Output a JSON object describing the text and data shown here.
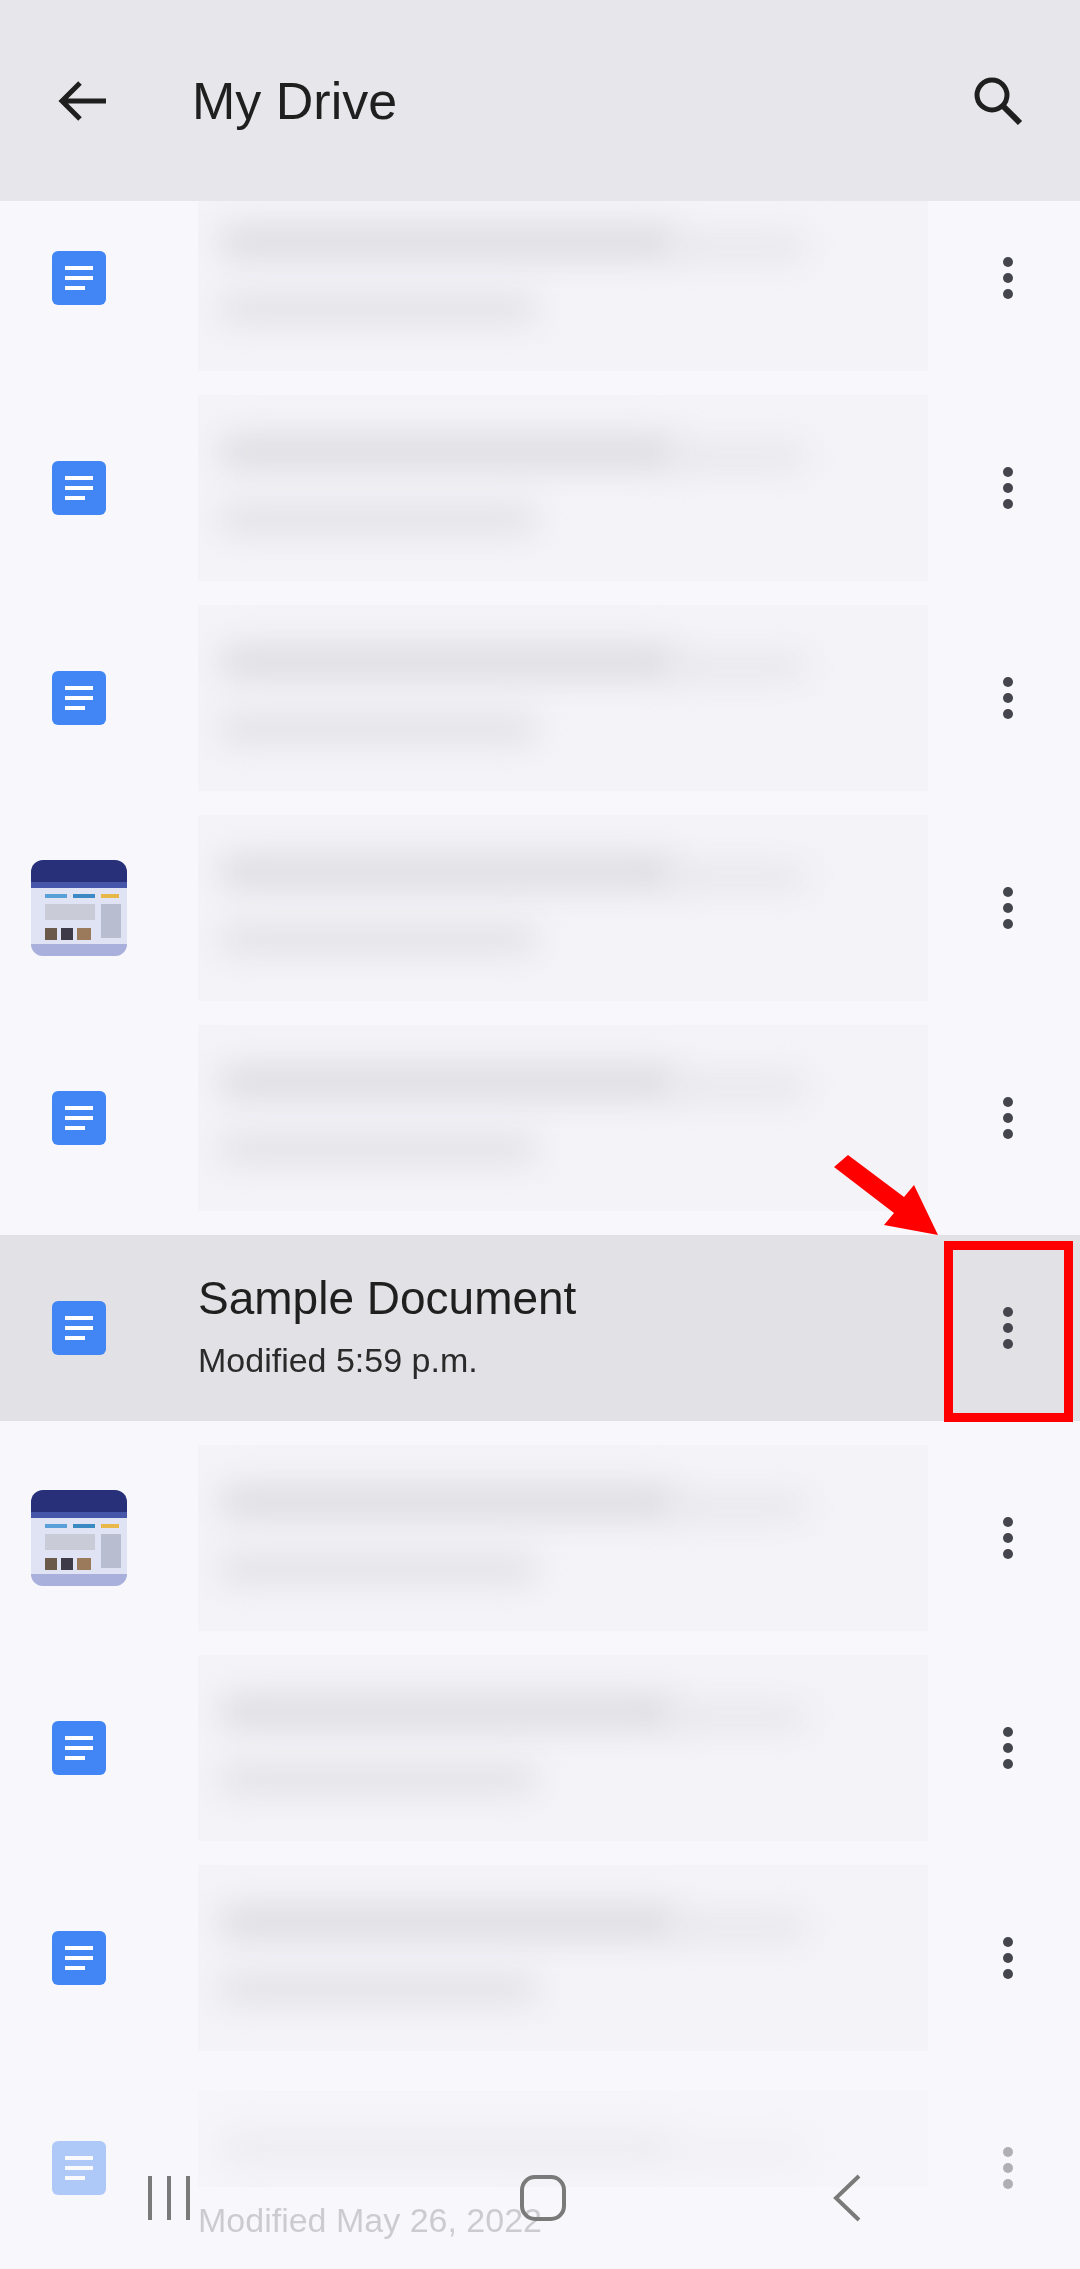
{
  "header": {
    "title": "My Drive"
  },
  "rows": [
    {
      "kind": "doc",
      "redacted": true,
      "selected": false,
      "annotated": false
    },
    {
      "kind": "doc",
      "redacted": true,
      "selected": false,
      "annotated": false
    },
    {
      "kind": "doc",
      "redacted": true,
      "selected": false,
      "annotated": false
    },
    {
      "kind": "picture",
      "redacted": true,
      "selected": false,
      "annotated": false
    },
    {
      "kind": "doc",
      "redacted": true,
      "selected": false,
      "annotated": false
    },
    {
      "kind": "doc",
      "redacted": false,
      "selected": true,
      "annotated": true,
      "title": "Sample Document",
      "subtitle": "Modified 5:59 p.m."
    },
    {
      "kind": "picture",
      "redacted": true,
      "selected": false,
      "annotated": false
    },
    {
      "kind": "doc",
      "redacted": true,
      "selected": false,
      "annotated": false
    },
    {
      "kind": "doc",
      "redacted": true,
      "selected": false,
      "annotated": false
    },
    {
      "kind": "doc",
      "redacted": true,
      "selected": false,
      "annotated": false,
      "faded": true,
      "subtitle": "Modified May 26, 2022"
    }
  ]
}
